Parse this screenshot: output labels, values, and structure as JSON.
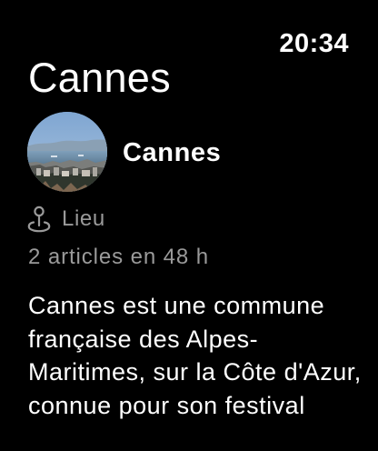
{
  "status": {
    "time": "20:34"
  },
  "page": {
    "title": "Cannes"
  },
  "place": {
    "name": "Cannes",
    "type_label": "Lieu",
    "articles_text": "2 articles en 48 h",
    "description": "Cannes est une commune française des Alpes-Maritimes, sur la Côte d'Azur, connue pour son festival"
  },
  "icons": {
    "location": "location-pin-icon"
  },
  "colors": {
    "background": "#000000",
    "primary_text": "#ffffff",
    "secondary_text": "#9a9a9a"
  }
}
